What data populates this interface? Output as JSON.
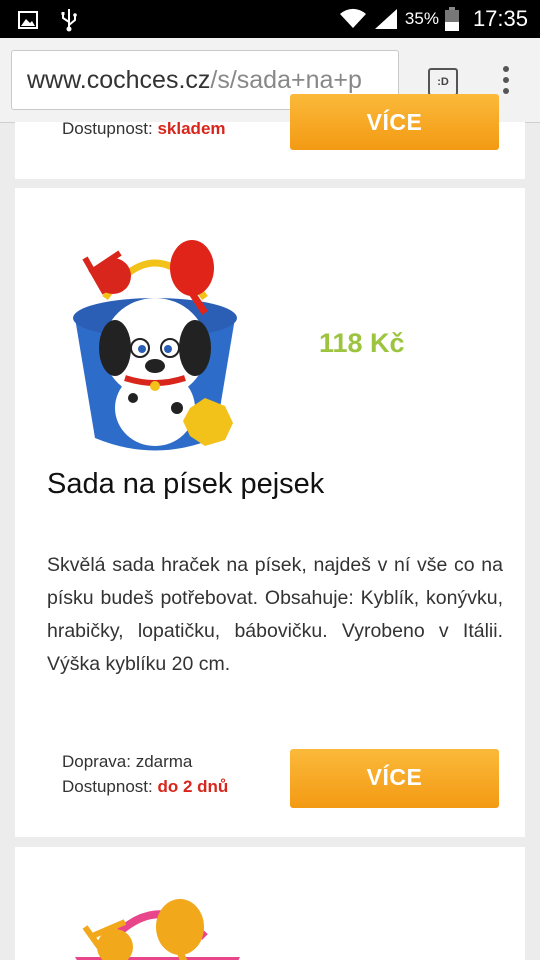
{
  "status_bar": {
    "battery_percent": "35%",
    "time": "17:35"
  },
  "browser": {
    "url_domain": "www.cochces.cz",
    "url_path": "/s/sada+na+p",
    "tab_switcher_label": ":D"
  },
  "products": [
    {
      "availability_label": "Dostupnost:",
      "availability_value": "skladem",
      "button_label": "VÍCE"
    },
    {
      "price": "118 Kč",
      "title": "Sada na písek pejsek",
      "description": "Skvělá sada hraček na písek, najdeš v ní vše co na písku budeš potřebovat. Obsahuje: Kyblík, konývku, hrabičky, lopatičku, bábovičku. Vyrobeno v Itálii. Výška kyblíku 20 cm.",
      "shipping": "Doprava: zdarma",
      "availability_label": "Dostupnost:",
      "availability_value": "do 2 dnů",
      "button_label": "VÍCE"
    }
  ],
  "colors": {
    "accent_orange": "#f5a623",
    "price_green": "#9cc43e",
    "availability_red": "#d9261c"
  }
}
